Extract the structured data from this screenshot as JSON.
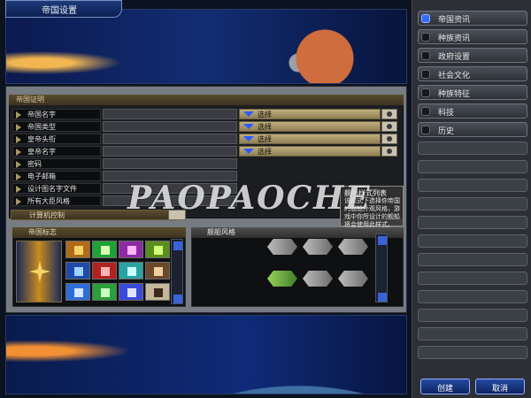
{
  "window": {
    "title": "帝国设置"
  },
  "sidebar": {
    "items": [
      {
        "label": "帝国资讯",
        "active": true
      },
      {
        "label": "种族资讯",
        "active": false
      },
      {
        "label": "政府设置",
        "active": false
      },
      {
        "label": "社会文化",
        "active": false
      },
      {
        "label": "种族特征",
        "active": false
      },
      {
        "label": "科技",
        "active": false
      },
      {
        "label": "历史",
        "active": false
      }
    ]
  },
  "empire_section": {
    "header": "帝国证明",
    "rows": [
      {
        "label": "帝国名字",
        "select_label": "选择"
      },
      {
        "label": "帝国类型",
        "select_label": "选择"
      },
      {
        "label": "皇帝头衔",
        "select_label": "选择"
      },
      {
        "label": "皇帝名字",
        "select_label": "选择"
      },
      {
        "label": "密码"
      },
      {
        "label": "电子邮箱"
      },
      {
        "label": "设计图名字文件"
      },
      {
        "label": "所有大臣风格"
      }
    ],
    "computer_control": "计算机控制"
  },
  "emblem_panel": {
    "header": "帝国标志"
  },
  "ship_panel": {
    "header": "舰船风格"
  },
  "tooltip": {
    "title": "舰船样式列表",
    "body": "该模式下选择你帝国的舰船外观风格，游戏中你所设计的舰船将会使用此样式。"
  },
  "watermark": "PAOPAOCHE",
  "buttons": {
    "create": "创建",
    "cancel": "取消"
  },
  "colors": {
    "accent_blue": "#2f6dff",
    "select_gold": "#bfae7d",
    "bg_dark": "#0b1220"
  }
}
